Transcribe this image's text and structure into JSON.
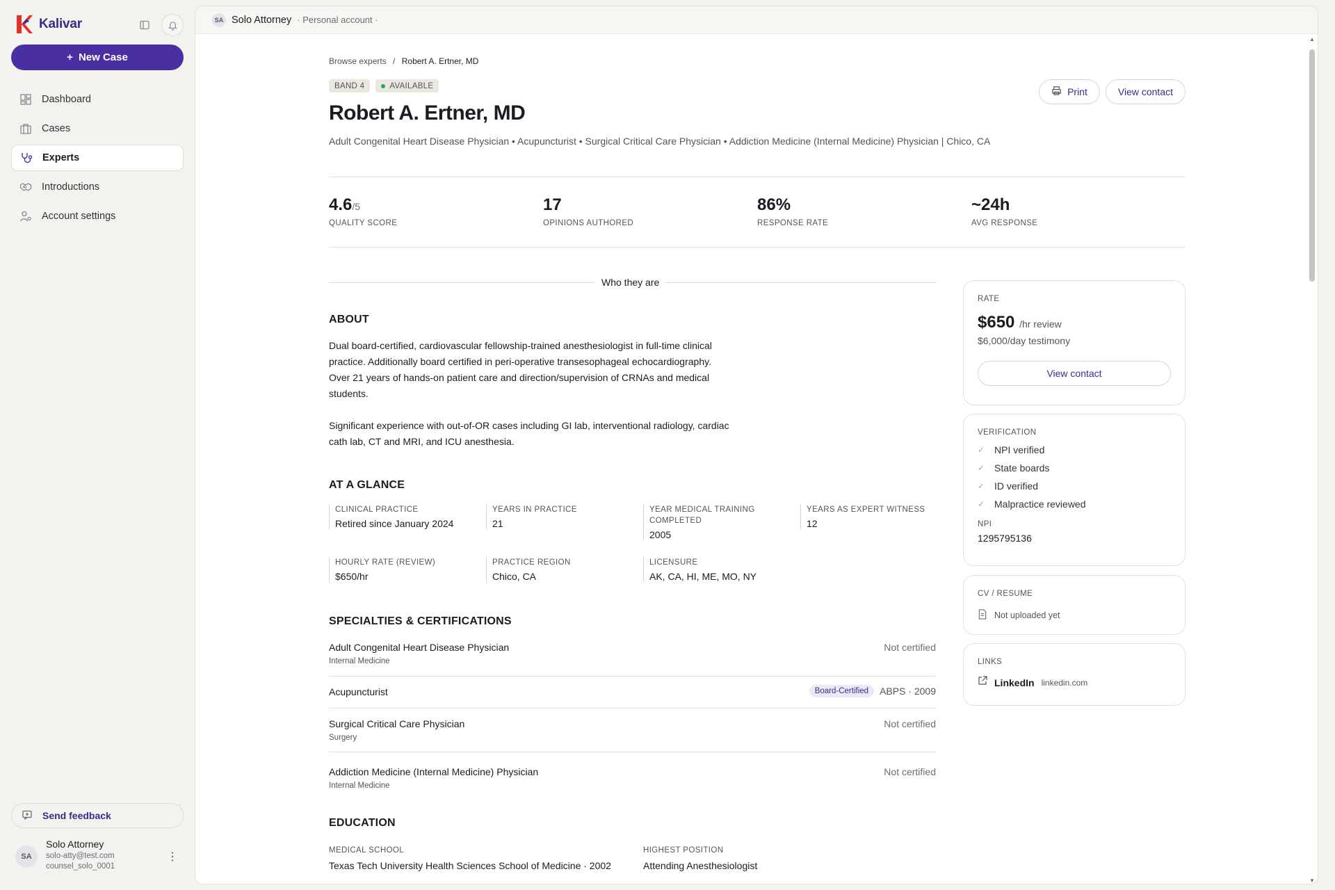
{
  "brand": {
    "name": "Kalivar",
    "accent": "#4a2fa2"
  },
  "sidebar": {
    "new_case_label": "New Case",
    "items": [
      {
        "label": "Dashboard",
        "icon": "dashboard-icon"
      },
      {
        "label": "Cases",
        "icon": "briefcase-icon"
      },
      {
        "label": "Experts",
        "icon": "stethoscope-icon"
      },
      {
        "label": "Introductions",
        "icon": "handshake-icon"
      },
      {
        "label": "Account settings",
        "icon": "user-gear-icon"
      }
    ],
    "active": "Experts",
    "feedback_label": "Send feedback",
    "user": {
      "initials": "SA",
      "name": "Solo Attorney",
      "email": "solo-atty@test.com",
      "handle": "counsel_solo_0001"
    }
  },
  "topbar": {
    "initials": "SA",
    "name": "Solo Attorney",
    "account": "· Personal account ·"
  },
  "breadcrumb": {
    "parent": "Browse experts",
    "sep": "/",
    "current": "Robert A. Ertner, MD"
  },
  "tags": {
    "band": "BAND 4",
    "status": "AVAILABLE"
  },
  "actions": {
    "print": "Print",
    "contact": "View contact"
  },
  "expert": {
    "name": "Robert A. Ertner, MD",
    "subtitle": "Adult Congenital Heart Disease Physician • Acupuncturist • Surgical Critical Care Physician • Addiction Medicine (Internal Medicine) Physician | Chico, CA"
  },
  "stats": [
    {
      "value": "4.6",
      "suffix": "/5",
      "label": "QUALITY SCORE"
    },
    {
      "value": "17",
      "suffix": "",
      "label": "OPINIONS AUTHORED"
    },
    {
      "value": "86%",
      "suffix": "",
      "label": "RESPONSE RATE"
    },
    {
      "value": "~24h",
      "suffix": "",
      "label": "AVG RESPONSE"
    }
  ],
  "who_heading": "Who they are",
  "about": {
    "heading": "ABOUT",
    "p1": "Dual board-certified, cardiovascular fellowship-trained anesthesiologist in full-time clinical practice. Additionally board certified in peri-operative transesophageal echocardiography. Over 21 years of hands-on patient care and direction/supervision of CRNAs and medical students.",
    "p2": "Significant experience with out-of-OR cases including GI lab, interventional radiology, cardiac cath lab, CT and MRI, and ICU anesthesia."
  },
  "glance": {
    "heading": "AT A GLANCE",
    "cells": [
      {
        "label": "CLINICAL PRACTICE",
        "value": "Retired since January 2024"
      },
      {
        "label": "YEARS IN PRACTICE",
        "value": "21"
      },
      {
        "label": "YEAR MEDICAL TRAINING COMPLETED",
        "value": "2005"
      },
      {
        "label": "YEARS AS EXPERT WITNESS",
        "value": "12"
      },
      {
        "label": "HOURLY RATE (REVIEW)",
        "value": "$650/hr"
      },
      {
        "label": "PRACTICE REGION",
        "value": "Chico, CA"
      },
      {
        "label": "LICENSURE",
        "value": "AK, CA, HI, ME, MO, NY"
      }
    ]
  },
  "specialties": {
    "heading": "SPECIALTIES & CERTIFICATIONS",
    "items": [
      {
        "name": "Adult Congenital Heart Disease Physician",
        "sub": "Internal Medicine",
        "status": "Not certified",
        "badge": "",
        "board": ""
      },
      {
        "name": "Acupuncturist",
        "sub": "",
        "status": "",
        "badge": "Board-Certified",
        "board": "ABPS · 2009"
      },
      {
        "name": "Surgical Critical Care Physician",
        "sub": "Surgery",
        "status": "Not certified",
        "badge": "",
        "board": ""
      },
      {
        "name": "Addiction Medicine (Internal Medicine) Physician",
        "sub": "Internal Medicine",
        "status": "Not certified",
        "badge": "",
        "board": ""
      }
    ]
  },
  "education": {
    "heading": "EDUCATION",
    "school_label": "MEDICAL SCHOOL",
    "school": "Texas Tech University Health Sciences School of Medicine · 2002",
    "position_label": "HIGHEST POSITION",
    "position": "Attending Anesthesiologist"
  },
  "rate_card": {
    "label": "RATE",
    "amount": "$650",
    "unit": "/hr review",
    "testimony": "$6,000/day testimony",
    "button": "View contact"
  },
  "verification": {
    "label": "VERIFICATION",
    "items": [
      "NPI verified",
      "State boards",
      "ID verified",
      "Malpractice reviewed"
    ],
    "npi_label": "NPI",
    "npi": "1295795136"
  },
  "cv": {
    "label": "CV / RESUME",
    "status": "Not uploaded yet"
  },
  "links": {
    "label": "LINKS",
    "name": "LinkedIn",
    "domain": "linkedin.com"
  }
}
